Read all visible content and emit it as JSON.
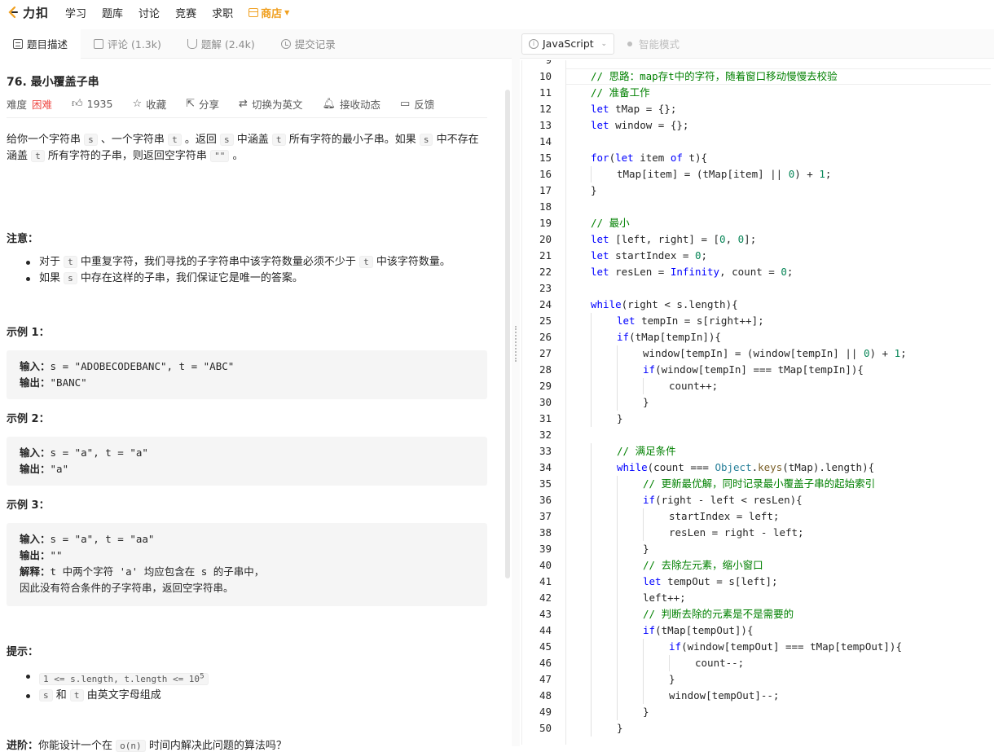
{
  "nav": {
    "logo_text": "力扣",
    "items": [
      "学习",
      "题库",
      "讨论",
      "竞赛",
      "求职"
    ],
    "store_label": "商店"
  },
  "tabs": [
    {
      "label": "题目描述"
    },
    {
      "label": "评论 (1.3k)"
    },
    {
      "label": "题解 (2.4k)"
    },
    {
      "label": "提交记录"
    }
  ],
  "problem": {
    "title": "76. 最小覆盖子串",
    "difficulty_label": "难度",
    "difficulty": "困难",
    "likes": "1935",
    "actions": [
      "收藏",
      "分享",
      "切换为英文",
      "接收动态",
      "反馈"
    ],
    "desc": {
      "p1": "给你一个字符串",
      "s": "s",
      "p2": "、一个字符串",
      "t": "t",
      "p3": "。返回",
      "p4": "中涵盖",
      "p5": "所有字符的最小子串。如果",
      "p6": "中不存在涵盖",
      "p7": "所有字符的子串，则返回空字符串",
      "empty": "\"\"",
      "p8": "。"
    },
    "note_title": "注意：",
    "notes": [
      {
        "a": "对于",
        "b": "中重复字符，我们寻找的子字符串中该字符数量必须不少于",
        "c": "中该字符数量。"
      },
      {
        "a": "如果",
        "b": "中存在这样的子串，我们保证它是唯一的答案。"
      }
    ],
    "examples": [
      {
        "title": "示例 1：",
        "input_label": "输入：",
        "input": "s = \"ADOBECODEBANC\", t = \"ABC\"",
        "output_label": "输出：",
        "output": "\"BANC\""
      },
      {
        "title": "示例 2：",
        "input_label": "输入：",
        "input": "s = \"a\", t = \"a\"",
        "output_label": "输出：",
        "output": "\"a\""
      },
      {
        "title": "示例 3：",
        "input_label": "输入：",
        "input": "s = \"a\", t = \"aa\"",
        "output_label": "输出：",
        "output": "\"\"",
        "explain_label": "解释：",
        "explain_1": "t 中两个字符 'a' 均应包含在 s 的子串中，",
        "explain_2": "因此没有符合条件的子字符串，返回空字符串。"
      }
    ],
    "tips_title": "提示：",
    "tips": {
      "t1": "1 <= s.length, t.length <= 10",
      "t1_sup": "5",
      "t2_a": "s",
      "t2_b": "和",
      "t2_c": "t",
      "t2_d": "由英文字母组成"
    },
    "advance_label": "进阶：",
    "advance_a": "你能设计一个在",
    "advance_code": "o(n)",
    "advance_b": "时间内解决此问题的算法吗？"
  },
  "editor": {
    "language": "JavaScript",
    "smart_mode": "智能模式",
    "top_partial_line": "9",
    "lines": [
      {
        "n": "10",
        "indent": 0,
        "html": "<span class='cm'>// 思路：map存t中的字符，随着窗口移动慢慢去校验</span>"
      },
      {
        "n": "11",
        "indent": 0,
        "html": "<span class='cm'>// 准备工作</span>"
      },
      {
        "n": "12",
        "indent": 0,
        "html": "<span class='kw'>let</span> tMap = {};"
      },
      {
        "n": "13",
        "indent": 0,
        "html": "<span class='kw'>let</span> window = {};"
      },
      {
        "n": "14",
        "indent": 0,
        "html": ""
      },
      {
        "n": "15",
        "indent": 0,
        "html": "<span class='kw'>for</span>(<span class='kw'>let</span> item <span class='kw'>of</span> t){"
      },
      {
        "n": "16",
        "indent": 1,
        "html": "tMap[item] = (tMap[item] || <span class='nm'>0</span>) + <span class='nm'>1</span>;"
      },
      {
        "n": "17",
        "indent": 0,
        "html": "}"
      },
      {
        "n": "18",
        "indent": 0,
        "html": ""
      },
      {
        "n": "19",
        "indent": 0,
        "html": "<span class='cm'>// 最小</span>"
      },
      {
        "n": "20",
        "indent": 0,
        "html": "<span class='kw'>let</span> [left, right] = [<span class='nm'>0</span>, <span class='nm'>0</span>];"
      },
      {
        "n": "21",
        "indent": 0,
        "html": "<span class='kw'>let</span> startIndex = <span class='nm'>0</span>;"
      },
      {
        "n": "22",
        "indent": 0,
        "html": "<span class='kw'>let</span> resLen = <span class='kw'>Infinity</span>, count = <span class='nm'>0</span>;"
      },
      {
        "n": "23",
        "indent": 0,
        "html": ""
      },
      {
        "n": "24",
        "indent": 0,
        "html": "<span class='kw'>while</span>(right &lt; s.length){"
      },
      {
        "n": "25",
        "indent": 1,
        "html": "<span class='kw'>let</span> tempIn = s[right++];"
      },
      {
        "n": "26",
        "indent": 1,
        "html": "<span class='kw'>if</span>(tMap[tempIn]){"
      },
      {
        "n": "27",
        "indent": 2,
        "html": "window[tempIn] = (window[tempIn] || <span class='nm'>0</span>) + <span class='nm'>1</span>;"
      },
      {
        "n": "28",
        "indent": 2,
        "html": "<span class='kw'>if</span>(window[tempIn] === tMap[tempIn]){"
      },
      {
        "n": "29",
        "indent": 3,
        "html": "count++;"
      },
      {
        "n": "30",
        "indent": 2,
        "html": "}"
      },
      {
        "n": "31",
        "indent": 1,
        "html": "}"
      },
      {
        "n": "32",
        "indent": 0,
        "html": ""
      },
      {
        "n": "33",
        "indent": 1,
        "html": "<span class='cm'>// 满足条件</span>"
      },
      {
        "n": "34",
        "indent": 1,
        "html": "<span class='kw'>while</span>(count === <span class='ob'>Object</span>.<span class='fn'>keys</span>(tMap).length){"
      },
      {
        "n": "35",
        "indent": 2,
        "html": "<span class='cm'>// 更新最优解，同时记录最小覆盖子串的起始索引</span>"
      },
      {
        "n": "36",
        "indent": 2,
        "html": "<span class='kw'>if</span>(right - left &lt; resLen){"
      },
      {
        "n": "37",
        "indent": 3,
        "html": "startIndex = left;"
      },
      {
        "n": "38",
        "indent": 3,
        "html": "resLen = right - left;"
      },
      {
        "n": "39",
        "indent": 2,
        "html": "}"
      },
      {
        "n": "40",
        "indent": 2,
        "html": "<span class='cm'>// 去除左元素，缩小窗口</span>"
      },
      {
        "n": "41",
        "indent": 2,
        "html": "<span class='kw'>let</span> tempOut = s[left];"
      },
      {
        "n": "42",
        "indent": 2,
        "html": "left++;"
      },
      {
        "n": "43",
        "indent": 2,
        "html": "<span class='cm'>// 判断去除的元素是不是需要的</span>"
      },
      {
        "n": "44",
        "indent": 2,
        "html": "<span class='kw'>if</span>(tMap[tempOut]){"
      },
      {
        "n": "45",
        "indent": 3,
        "html": "<span class='kw'>if</span>(window[tempOut] === tMap[tempOut]){"
      },
      {
        "n": "46",
        "indent": 4,
        "html": "count--;"
      },
      {
        "n": "47",
        "indent": 3,
        "html": "}"
      },
      {
        "n": "48",
        "indent": 3,
        "html": "window[tempOut]--;"
      },
      {
        "n": "49",
        "indent": 2,
        "html": "}"
      },
      {
        "n": "50",
        "indent": 1,
        "html": "}"
      }
    ]
  }
}
